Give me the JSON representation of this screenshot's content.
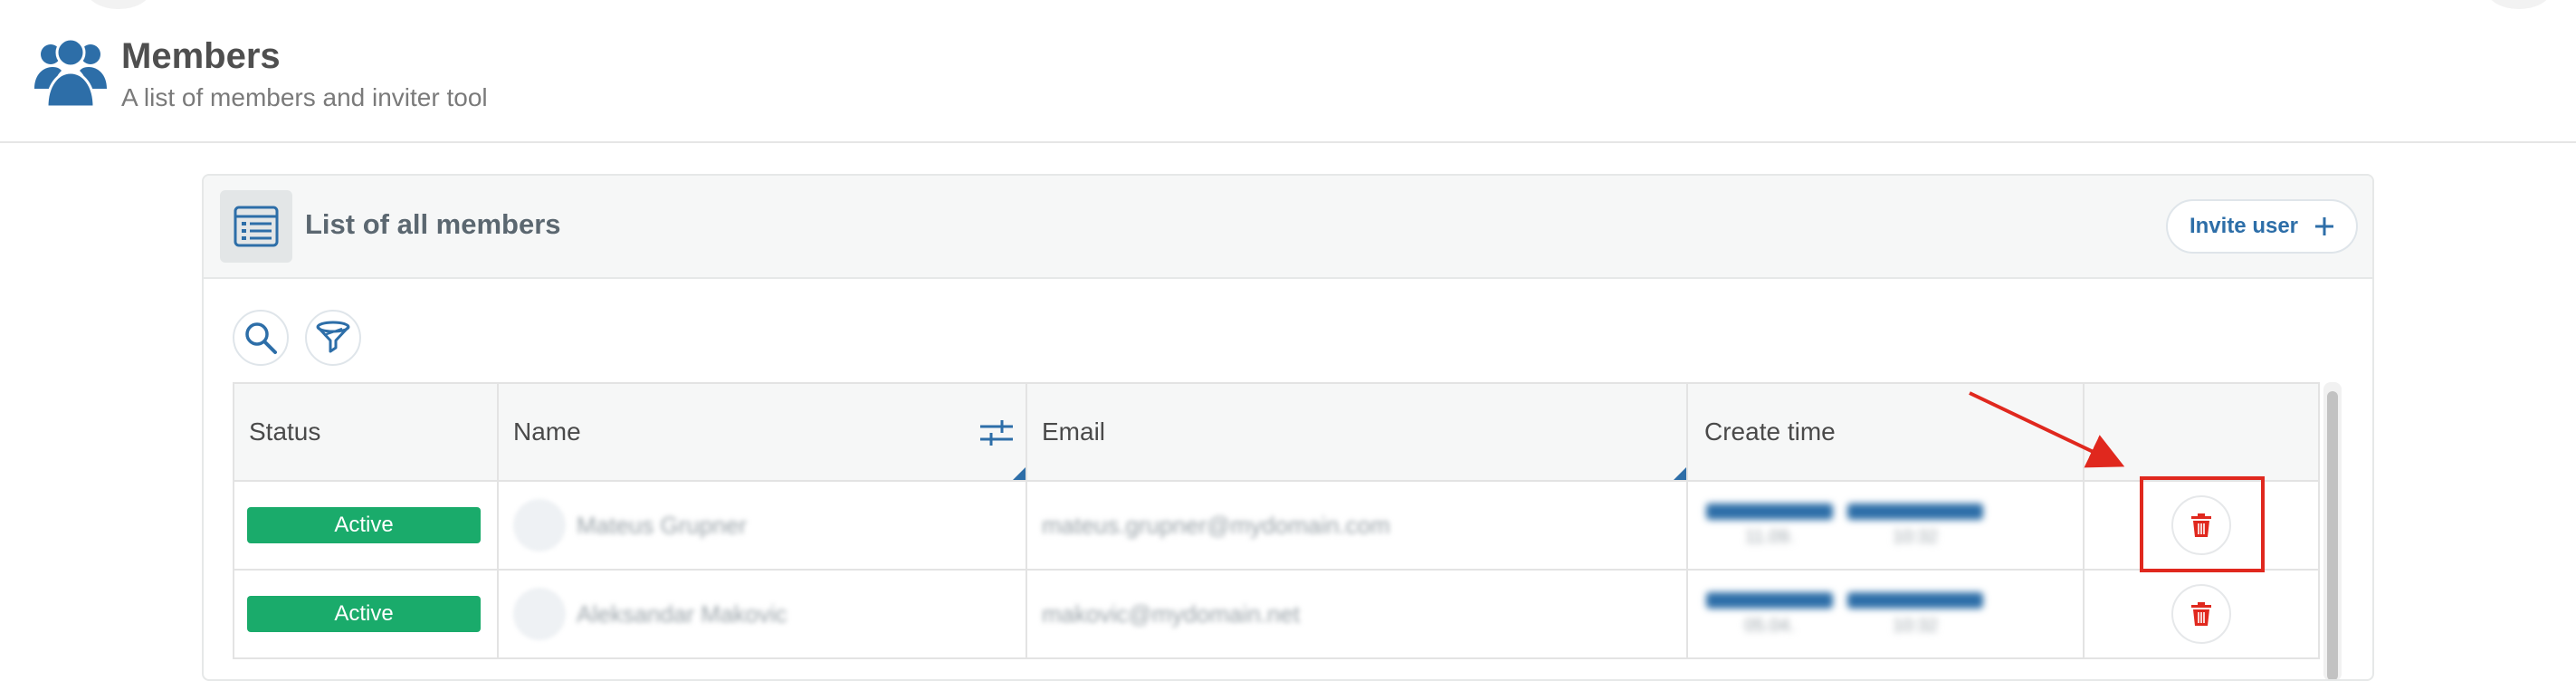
{
  "header": {
    "title": "Members",
    "subtitle": "A list of members and inviter tool",
    "icon": "users-icon"
  },
  "card": {
    "title": "List of all members",
    "icon": "list-icon",
    "invite_button": "Invite user",
    "invite_icon": "plus-icon",
    "tools": [
      "search-icon",
      "filter-icon"
    ]
  },
  "table": {
    "columns": [
      "Status",
      "Name",
      "Email",
      "Create time",
      ""
    ],
    "rows": [
      {
        "status": "Active",
        "name": "Mateus Grupner",
        "email": "mateus.grupner@mydomain.com",
        "date": "11.09.",
        "time": "10:32",
        "action_icon": "trash-icon"
      },
      {
        "status": "Active",
        "name": "Aleksandar Makovic",
        "email": "makovic@mydomain.net",
        "date": "05.04.",
        "time": "10:32",
        "action_icon": "trash-icon"
      }
    ]
  },
  "colors": {
    "accent": "#2d6ea8",
    "active": "#1aab6b",
    "danger": "#e0281e"
  },
  "annotation": {
    "type": "arrow-and-box",
    "target": "delete-button-row-1"
  }
}
